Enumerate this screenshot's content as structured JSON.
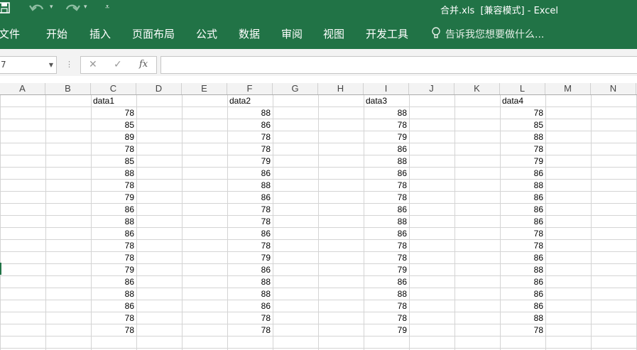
{
  "window": {
    "title": "合并.xls  [兼容模式] - Excel"
  },
  "quick_access": {
    "save_icon": "save-icon",
    "undo_icon": "undo-icon",
    "redo_icon": "redo-icon",
    "dropdown_glyph": "▾",
    "customize_glyph": "⩡"
  },
  "ribbon": {
    "tabs": [
      "文件",
      "开始",
      "插入",
      "页面布局",
      "公式",
      "数据",
      "审阅",
      "视图",
      "开发工具"
    ],
    "tell_me": "告诉我您想要做什么...",
    "accent_color": "#217346"
  },
  "formula_bar": {
    "name_box": "7",
    "cancel_glyph": "✕",
    "enter_glyph": "✓",
    "fx_label": "fx",
    "formula": ""
  },
  "sheet": {
    "columns": [
      "A",
      "B",
      "C",
      "D",
      "E",
      "F",
      "G",
      "H",
      "I",
      "J",
      "K",
      "L",
      "M",
      "N"
    ],
    "headers": {
      "C": "data1",
      "F": "data2",
      "I": "data3",
      "L": "data4"
    },
    "data": {
      "C": [
        78,
        85,
        89,
        78,
        85,
        88,
        78,
        79,
        86,
        88,
        86,
        78,
        78,
        79,
        86,
        88,
        86,
        78,
        78
      ],
      "F": [
        88,
        86,
        78,
        78,
        79,
        86,
        88,
        86,
        78,
        78,
        86,
        78,
        79,
        86,
        88,
        88,
        86,
        78,
        78
      ],
      "I": [
        88,
        78,
        79,
        86,
        88,
        86,
        78,
        78,
        86,
        88,
        86,
        78,
        78,
        79,
        86,
        88,
        78,
        78,
        79
      ],
      "L": [
        78,
        85,
        88,
        78,
        79,
        86,
        88,
        86,
        86,
        86,
        78,
        78,
        86,
        88,
        86,
        86,
        86,
        88,
        78
      ]
    }
  }
}
